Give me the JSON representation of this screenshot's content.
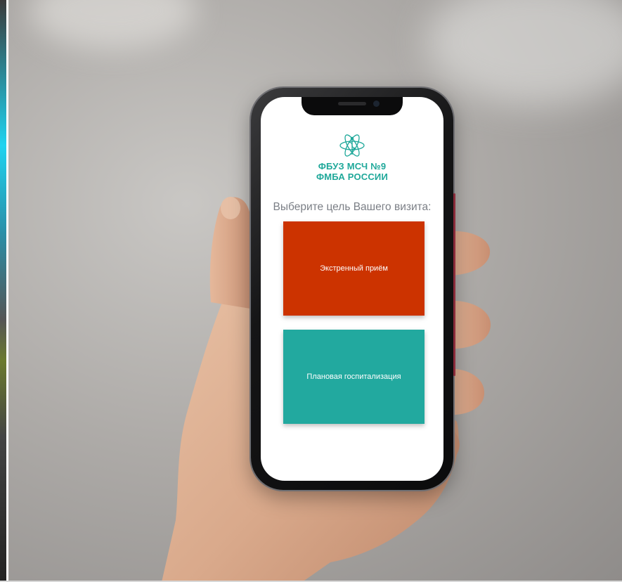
{
  "logo": {
    "icon": "atom-caduceus-icon",
    "line1": "ФБУЗ МСЧ №9",
    "line2": "ФМБА РОССИИ"
  },
  "prompt": "Выберите цель Вашего визита:",
  "buttons": {
    "emergency": "Экстренный приём",
    "planned": "Плановая госпитализация"
  },
  "colors": {
    "brand": "#1fa89a",
    "emergency": "#cc3300",
    "planned": "#22a99f",
    "prompt_text": "#7b7f86"
  }
}
